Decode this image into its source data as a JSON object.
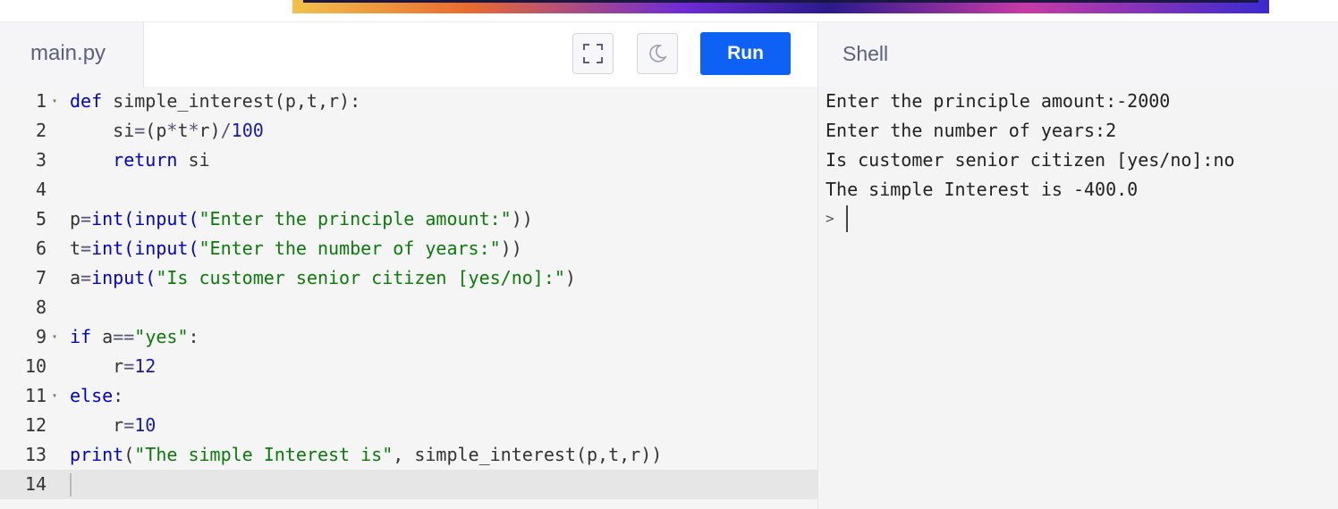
{
  "banner": {
    "colors": [
      "#f2c14b",
      "#e96b2e",
      "#6e2bd6",
      "#c83aa6"
    ]
  },
  "editor_tab": {
    "filename": "main.py"
  },
  "toolbar": {
    "fullscreen_icon": "expand-icon",
    "theme_icon": "moon-icon",
    "run_label": "Run",
    "run_color": "#0d61f4"
  },
  "shell_tab": {
    "label": "Shell"
  },
  "code": {
    "lines": [
      {
        "num": "1",
        "fold": true
      },
      {
        "num": "2"
      },
      {
        "num": "3"
      },
      {
        "num": "4"
      },
      {
        "num": "5"
      },
      {
        "num": "6"
      },
      {
        "num": "7"
      },
      {
        "num": "8"
      },
      {
        "num": "9",
        "fold": true
      },
      {
        "num": "10"
      },
      {
        "num": "11",
        "fold": true
      },
      {
        "num": "12"
      },
      {
        "num": "13"
      },
      {
        "num": "14",
        "active": true
      }
    ],
    "tokens": {
      "l1": [
        "def",
        " simple_interest(p,t,r):"
      ],
      "l2": [
        "    si",
        "=",
        "(p",
        "*",
        "t",
        "*",
        "r)",
        "/",
        "100"
      ],
      "l3": [
        "    ",
        "return",
        " si"
      ],
      "l5": [
        "p",
        "=",
        "int(input(",
        "\"Enter the principle amount:\"",
        "))"
      ],
      "l6": [
        "t",
        "=",
        "int(input(",
        "\"Enter the number of years:\"",
        "))"
      ],
      "l7": [
        "a",
        "=",
        "input(",
        "\"Is customer senior citizen [yes/no]:\"",
        ")"
      ],
      "l9": [
        "if",
        " a",
        "==",
        "\"yes\"",
        ":"
      ],
      "l10": [
        "    r",
        "=",
        "12"
      ],
      "l11": [
        "else",
        ":"
      ],
      "l12": [
        "    r",
        "=",
        "10"
      ],
      "l13": [
        "print",
        "(",
        "\"The simple Interest is\"",
        ", simple_interest(p,t,r))"
      ]
    }
  },
  "shell": {
    "output": [
      "Enter the principle amount:-2000",
      "Enter the number of years:2",
      "Is customer senior citizen [yes/no]:no",
      "The simple Interest is -400.0"
    ],
    "prompt": ">"
  }
}
